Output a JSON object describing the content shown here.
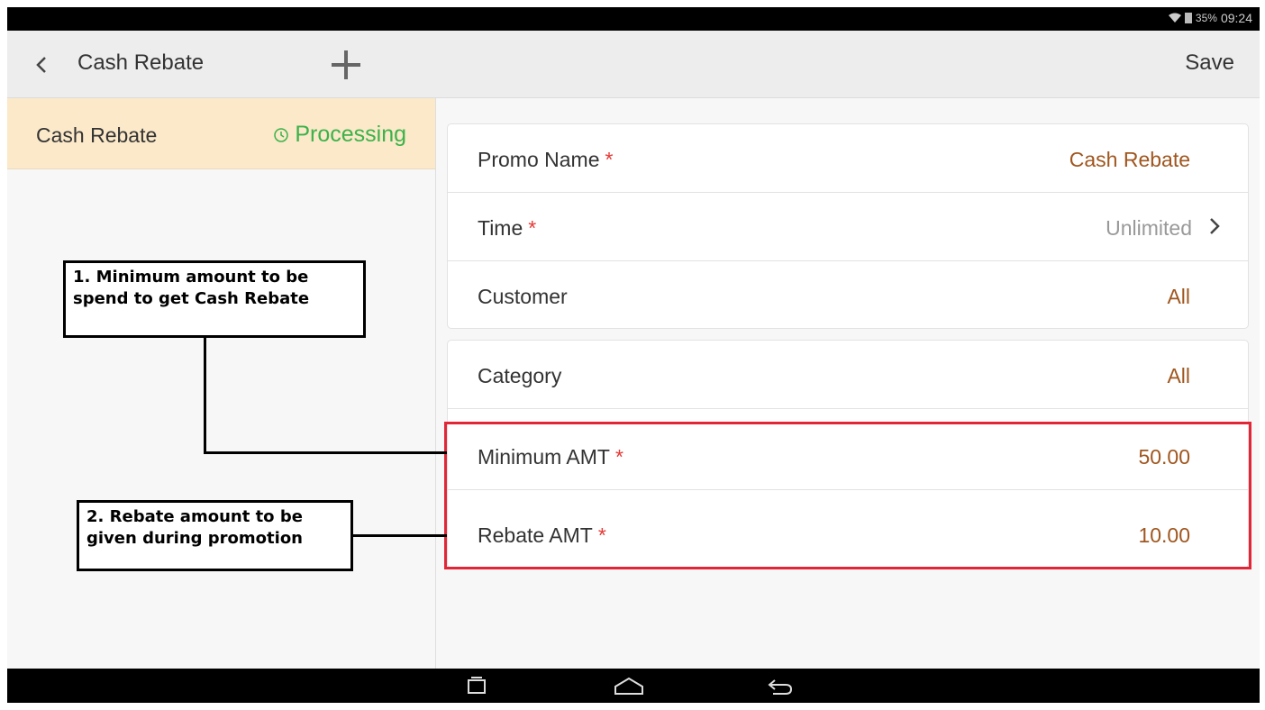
{
  "status": {
    "battery": "35%",
    "time": "09:24"
  },
  "appbar": {
    "title": "Cash Rebate",
    "save_label": "Save"
  },
  "left_list": {
    "items": [
      {
        "name": "Cash Rebate",
        "status": "Processing"
      }
    ]
  },
  "form": {
    "promo_name": {
      "label": "Promo Name",
      "required": "*",
      "value": "Cash Rebate"
    },
    "time": {
      "label": "Time",
      "required": "*",
      "value": "Unlimited"
    },
    "customer": {
      "label": "Customer",
      "value": "All"
    },
    "category": {
      "label": "Category",
      "value": "All"
    },
    "minimum_amt": {
      "label": "Minimum AMT",
      "required": "*",
      "value": "50.00"
    },
    "rebate_amt": {
      "label": "Rebate AMT",
      "required": "*",
      "value": "10.00"
    }
  },
  "annotations": {
    "note1_line1": "1. Minimum amount to be",
    "note1_line2": "spend to get Cash Rebate",
    "note2_line1": "2. Rebate amount to be",
    "note2_line2": "given during promotion"
  },
  "colors": {
    "accent_value": "#a0561e",
    "status_green": "#3cb24a",
    "highlight_red": "#e32636",
    "selected_bg": "#fbe9c9"
  },
  "icons": [
    "wifi-icon",
    "battery-icon",
    "back-icon",
    "plus-icon",
    "clock-icon",
    "chevron-right-icon",
    "recent-apps-icon",
    "home-icon",
    "nav-back-icon"
  ]
}
